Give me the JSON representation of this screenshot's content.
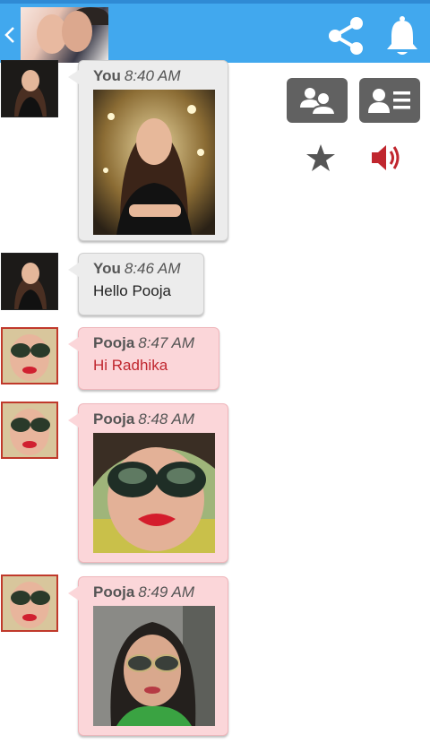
{
  "header": {
    "back_icon": "chevron-left-icon",
    "share_icon": "share-icon",
    "bell_icon": "bell-icon",
    "accent_color": "#41a8ee"
  },
  "actions": {
    "group_icon": "group-icon",
    "contact_card_icon": "contact-card-icon",
    "star_icon": "star-icon",
    "speaker_icon": "speaker-icon",
    "speaker_color": "#c0262e"
  },
  "messages": [
    {
      "sender": "You",
      "time": "8:40 AM",
      "type": "image",
      "side": "you"
    },
    {
      "sender": "You",
      "time": "8:46 AM",
      "type": "text",
      "text": "Hello Pooja",
      "side": "you"
    },
    {
      "sender": "Pooja",
      "time": "8:47 AM",
      "type": "text",
      "text": "Hi Radhika",
      "side": "pooja"
    },
    {
      "sender": "Pooja",
      "time": "8:48 AM",
      "type": "image",
      "side": "pooja"
    },
    {
      "sender": "Pooja",
      "time": "8:49 AM",
      "type": "image",
      "side": "pooja"
    }
  ]
}
